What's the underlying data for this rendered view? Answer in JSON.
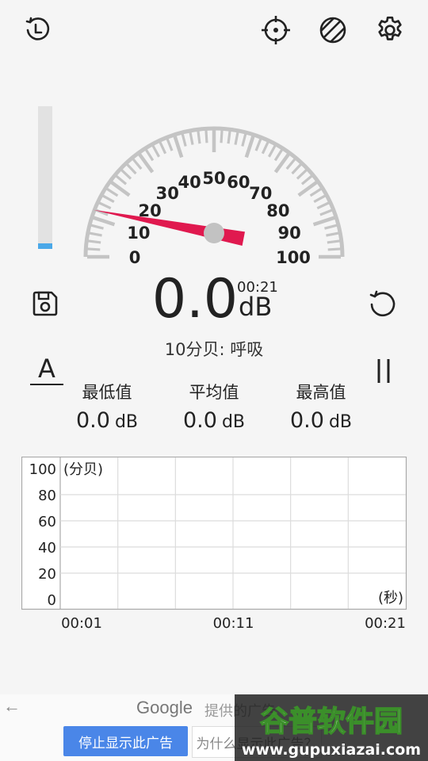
{
  "toolbar": {
    "history_icon": "history-icon",
    "calibrate_icon": "crosshair-icon",
    "theme_icon": "hatched-circle-icon",
    "settings_icon": "gear-icon"
  },
  "level_meter": {
    "level_fraction": 0.04,
    "fill_color": "#4aa8e8"
  },
  "gauge": {
    "min": 0,
    "max": 100,
    "labels": [
      "0",
      "10",
      "20",
      "30",
      "40",
      "50",
      "60",
      "70",
      "80",
      "90",
      "100"
    ],
    "needle_value": 0,
    "needle_color": "#e0194f",
    "scale_color": "#c4c4c4"
  },
  "reading": {
    "value": "0.0",
    "unit": "dB",
    "elapsed": "00:21",
    "description": "10分贝: 呼吸"
  },
  "controls": {
    "save_icon": "save-icon",
    "reset_icon": "reset-icon",
    "pause_icon": "pause-icon",
    "weighting": "A"
  },
  "stats": {
    "min_label": "最低值",
    "min_value": "0.0",
    "avg_label": "平均值",
    "avg_value": "0.0",
    "max_label": "最高值",
    "max_value": "0.0",
    "unit": "dB"
  },
  "chart_data": {
    "type": "line",
    "ylabel": "(分贝)",
    "xlabel": "(秒)",
    "ylim": [
      0,
      100
    ],
    "y_ticks": [
      "100",
      "80",
      "60",
      "40",
      "20",
      "0"
    ],
    "x_ticks": [
      "00:01",
      "00:11",
      "00:21"
    ],
    "grid": true,
    "series": [
      {
        "values": []
      }
    ]
  },
  "ad": {
    "back_icon": "←",
    "brand": "Google",
    "provided_text": "提供的广告",
    "stop_label": "停止显示此广告",
    "why_label": "为什么显示此广告？"
  },
  "watermark": {
    "title": "谷普软件园",
    "url": "www.gupuxiazai.com"
  }
}
